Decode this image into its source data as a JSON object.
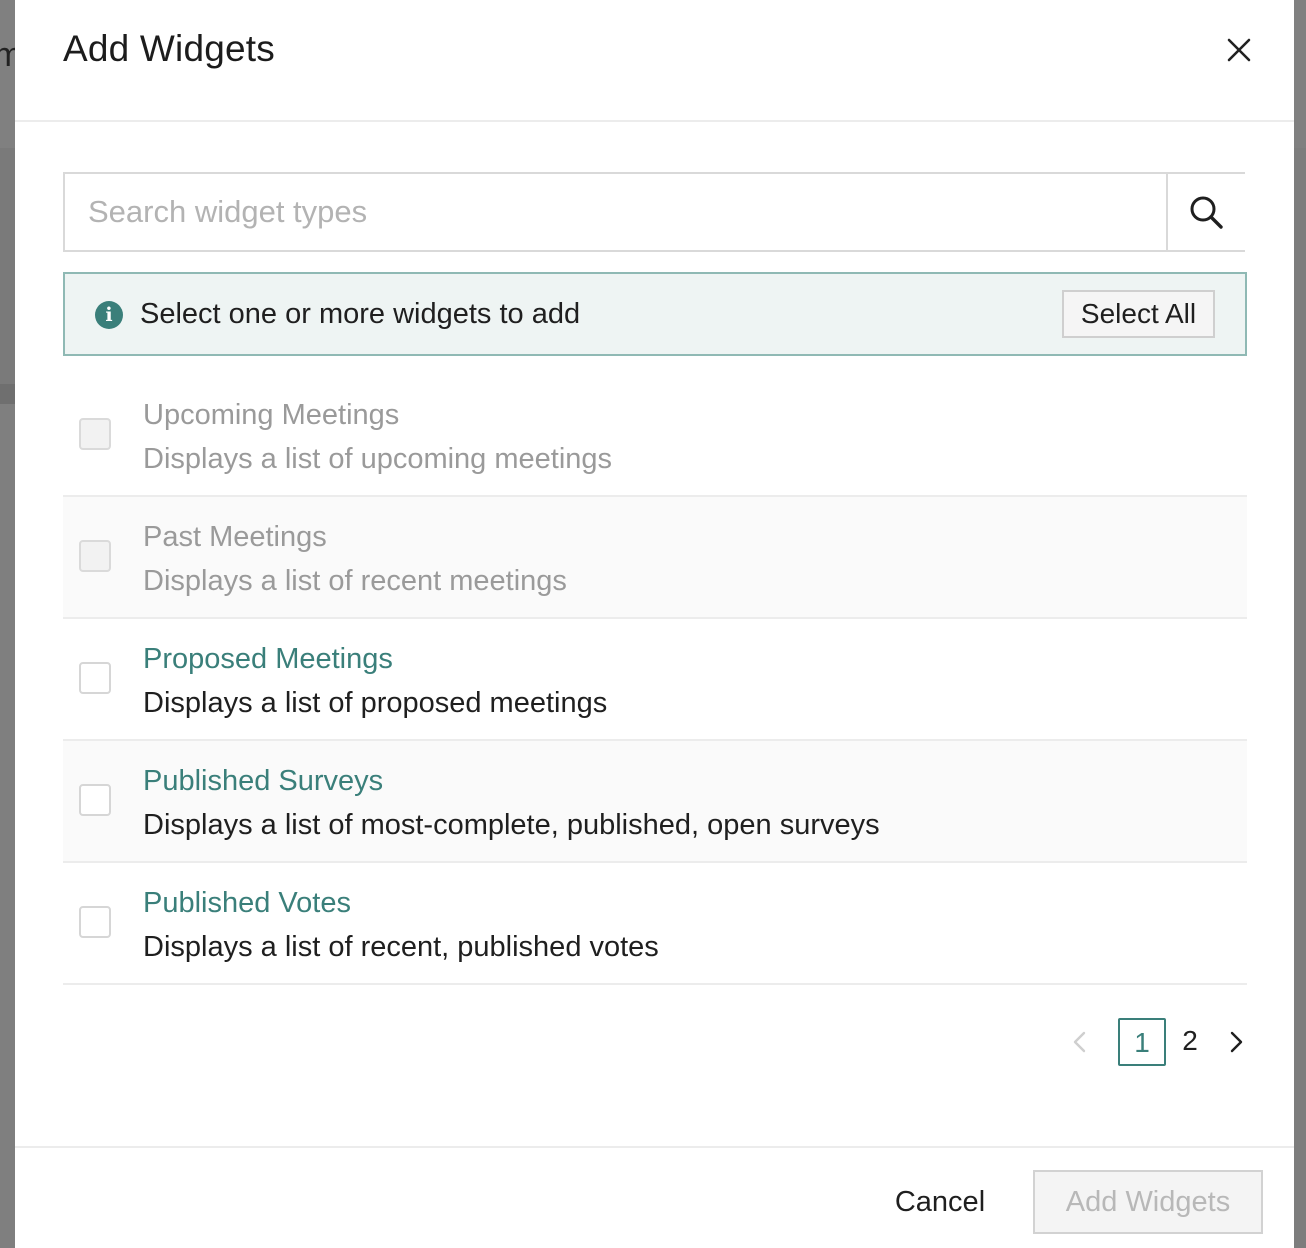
{
  "modal": {
    "title": "Add Widgets"
  },
  "search": {
    "placeholder": "Search widget types",
    "value": ""
  },
  "banner": {
    "icon": "info-icon",
    "glyph": "i",
    "text": "Select one or more widgets to add",
    "select_all_label": "Select All"
  },
  "widgets": [
    {
      "title": "Upcoming Meetings",
      "description": "Displays a list of upcoming meetings",
      "disabled": true,
      "checked": false
    },
    {
      "title": "Past Meetings",
      "description": "Displays a list of recent meetings",
      "disabled": true,
      "checked": false
    },
    {
      "title": "Proposed Meetings",
      "description": "Displays a list of proposed meetings",
      "disabled": false,
      "checked": false
    },
    {
      "title": "Published Surveys",
      "description": "Displays a list of most-complete, published, open surveys",
      "disabled": false,
      "checked": false
    },
    {
      "title": "Published Votes",
      "description": "Displays a list of recent, published votes",
      "disabled": false,
      "checked": false
    }
  ],
  "pagination": {
    "pages": [
      "1",
      "2"
    ],
    "current": "1"
  },
  "footer": {
    "cancel_label": "Cancel",
    "add_label": "Add Widgets"
  },
  "colors": {
    "accent": "#3a7f7a",
    "banner_bg": "#eef4f3",
    "banner_border": "#8fb9b4",
    "disabled_text": "#9a9a9a",
    "overlay": "#7d7d7d"
  }
}
